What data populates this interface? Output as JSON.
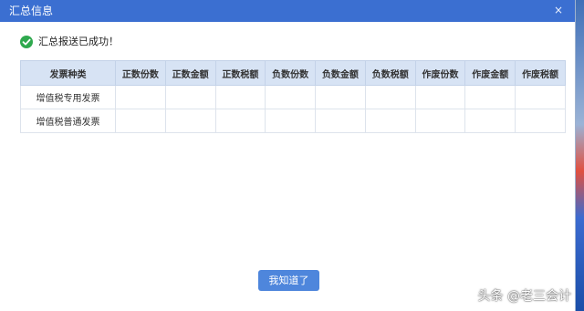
{
  "dialog": {
    "title": "汇总信息",
    "close_icon": "close-icon",
    "close_glyph": "×",
    "status_icon": "check-circle-icon",
    "status_color": "#2fa94e",
    "message": "汇总报送已成功！"
  },
  "table": {
    "columns": [
      "发票种类",
      "正数份数",
      "正数金额",
      "正数税额",
      "负数份数",
      "负数金额",
      "负数税额",
      "作废份数",
      "作废金额",
      "作废税额"
    ],
    "rows": [
      {
        "type": "增值税专用发票",
        "values": [
          "",
          "",
          "",
          "",
          "",
          "",
          "",
          "",
          ""
        ]
      },
      {
        "type": "增值税普通发票",
        "values": [
          "",
          "",
          "",
          "",
          "",
          "",
          "",
          "",
          ""
        ]
      }
    ]
  },
  "footer": {
    "ok_label": "我知道了"
  },
  "watermark": "头条 @老三会计",
  "colors": {
    "titlebar": "#3b6fd1",
    "header_bg": "#d7e3f4",
    "button": "#4e86dc"
  }
}
